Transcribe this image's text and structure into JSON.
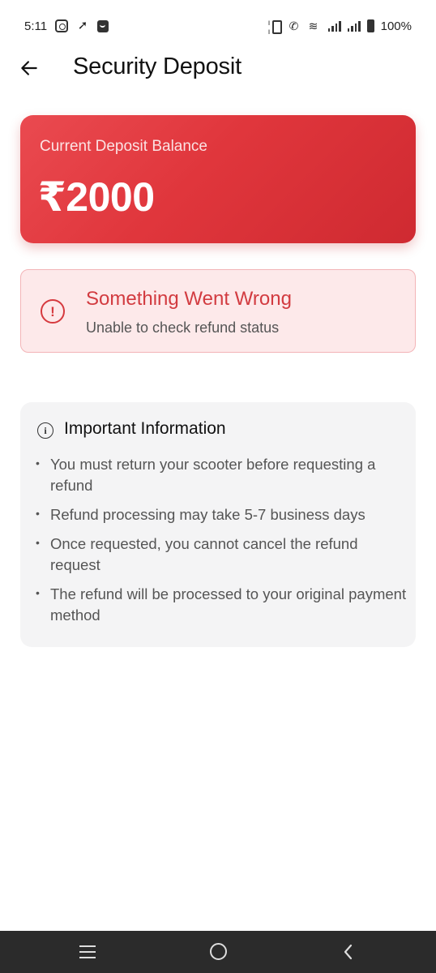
{
  "status_bar": {
    "time": "5:11",
    "left_icons": [
      "instagram-icon",
      "navigation-icon",
      "bag-icon"
    ],
    "right_icons": [
      "vibrate-icon",
      "call-icon",
      "wifi-icon",
      "signal-icon",
      "signal-icon",
      "battery-icon"
    ],
    "battery": "100%"
  },
  "header": {
    "back_icon": "arrow-left-icon",
    "title": "Security Deposit"
  },
  "deposit_card": {
    "label": "Current Deposit Balance",
    "amount": "₹2000",
    "gradient_start": "#ea4a50",
    "gradient_end": "#cf2a31"
  },
  "error_box": {
    "icon": "alert-circle-icon",
    "title": "Something Went Wrong",
    "subtitle": "Unable to check refund status",
    "accent_color": "#d23b40",
    "background": "#fde9ea"
  },
  "info_box": {
    "icon": "info-circle-icon",
    "title": "Important Information",
    "items": [
      "You must return your scooter before requesting a refund",
      "Refund processing may take 5-7 business days",
      "Once requested, you cannot cancel the refund request",
      "The refund will be processed to your original payment method"
    ]
  },
  "bottom_nav": {
    "buttons": [
      "recent-apps-icon",
      "home-icon",
      "back-icon"
    ]
  }
}
